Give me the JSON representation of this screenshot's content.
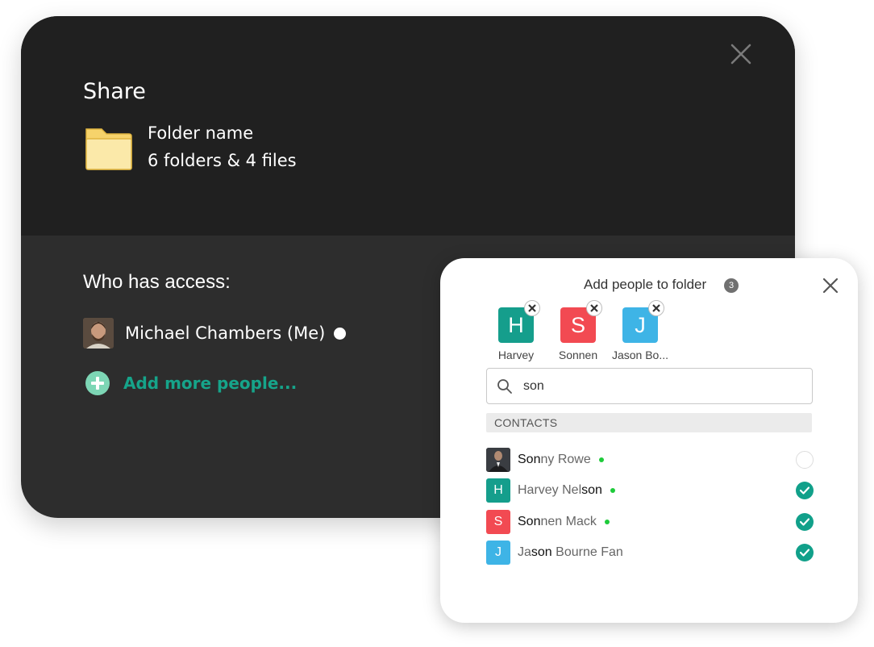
{
  "share_dialog": {
    "title": "Share",
    "folder": {
      "name": "Folder name",
      "summary": "6 folders & 4 files",
      "icon": "folder-icon"
    },
    "access_heading": "Who has access:",
    "owner": {
      "name": "Michael Chambers (Me)"
    },
    "add_more_label": "Add more people..."
  },
  "add_panel": {
    "title": "Add people to folder",
    "count": "3",
    "chips": [
      {
        "initial": "H",
        "label": "Harvey",
        "color": "#159e8c"
      },
      {
        "initial": "S",
        "label": "Sonnen",
        "color": "#f24a52"
      },
      {
        "initial": "J",
        "label": "Jason Bo...",
        "color": "#3eb4e6"
      }
    ],
    "search": {
      "value": "son",
      "icon": "search-icon"
    },
    "contacts_header": "CONTACTS",
    "contacts": [
      {
        "initial": "",
        "name_parts": [
          "Son",
          "ny Rowe"
        ],
        "online": true,
        "selected": false,
        "color": "#2a2a2a"
      },
      {
        "initial": "H",
        "name_parts": [
          "Harvey Nel",
          "son"
        ],
        "online": true,
        "selected": true,
        "color": "#159e8c"
      },
      {
        "initial": "S",
        "name_parts": [
          "Son",
          "nen Mack"
        ],
        "online": true,
        "selected": true,
        "color": "#f24a52"
      },
      {
        "initial": "J",
        "name_parts": [
          "Ja",
          "son",
          " Bourne Fan"
        ],
        "online": false,
        "selected": true,
        "color": "#3eb4e6"
      }
    ]
  }
}
